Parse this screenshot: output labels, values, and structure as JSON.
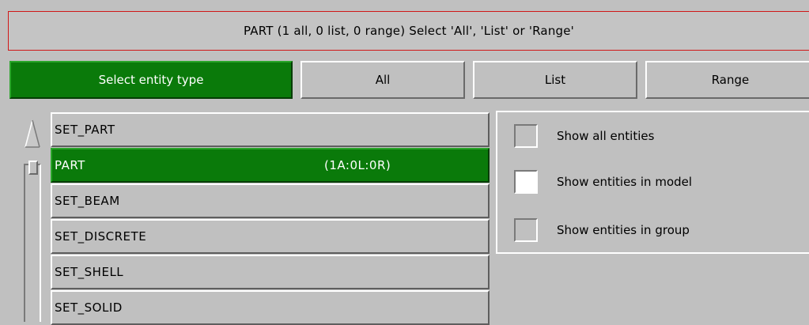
{
  "header": {
    "title": "PART (1 all, 0 list, 0 range) Select 'All', 'List' or 'Range'"
  },
  "toolbar": {
    "select_entity_type": "Select entity type",
    "all": "All",
    "list": "List",
    "range": "Range"
  },
  "entity_list": {
    "items": [
      {
        "label": "SET_PART",
        "count": "",
        "selected": false
      },
      {
        "label": "PART",
        "count": "(1A:0L:0R)",
        "selected": true
      },
      {
        "label": "SET_BEAM",
        "count": "",
        "selected": false
      },
      {
        "label": "SET_DISCRETE",
        "count": "",
        "selected": false
      },
      {
        "label": "SET_SHELL",
        "count": "",
        "selected": false
      },
      {
        "label": "SET_SOLID",
        "count": "",
        "selected": false
      }
    ]
  },
  "options": {
    "show_all": {
      "label": "Show all entities",
      "checked": false
    },
    "show_model": {
      "label": "Show entities in model",
      "checked": true
    },
    "show_group": {
      "label": "Show entities in group",
      "checked": false
    }
  },
  "colors": {
    "active_green": "#0a7a0a",
    "background_grey": "#c0c0c0",
    "header_border_red": "#d01818"
  },
  "icons": {
    "scroll_up": "triangle-up-icon"
  }
}
